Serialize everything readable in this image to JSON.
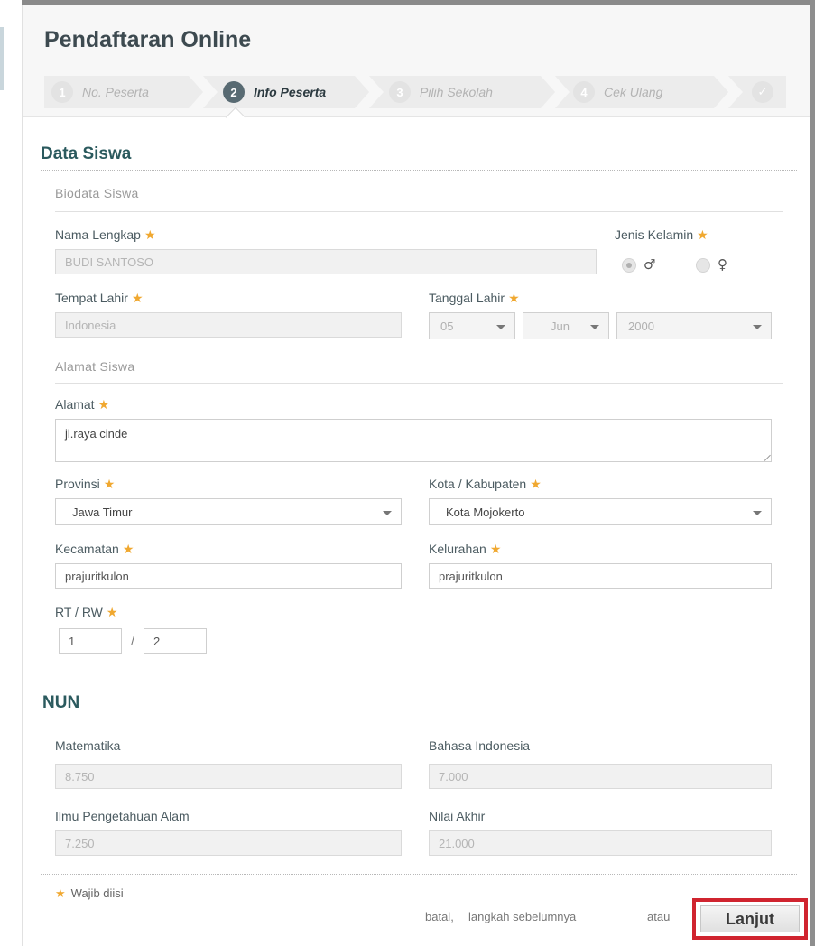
{
  "app": {
    "title": "Pendaftaran Online"
  },
  "wizard": {
    "steps": [
      {
        "num": "1",
        "label": "No. Peserta"
      },
      {
        "num": "2",
        "label": "Info Peserta"
      },
      {
        "num": "3",
        "label": "Pilih Sekolah"
      },
      {
        "num": "4",
        "label": "Cek Ulang"
      },
      {
        "num": "✓",
        "label": ""
      }
    ]
  },
  "data_siswa": {
    "title": "Data Siswa",
    "biodata": {
      "title": "Biodata Siswa",
      "nama_label": "Nama Lengkap",
      "nama_value": "BUDI SANTOSO",
      "gender_label": "Jenis Kelamin",
      "male_symbol": "♂",
      "female_symbol": "♀",
      "tempat_label": "Tempat Lahir",
      "tempat_value": "Indonesia",
      "tanggal_label": "Tanggal Lahir",
      "day": "05",
      "month": "Jun",
      "year": "2000"
    },
    "alamat": {
      "title": "Alamat Siswa",
      "alamat_label": "Alamat",
      "alamat_value": "jl.raya cinde",
      "provinsi_label": "Provinsi",
      "provinsi_value": "Jawa Timur",
      "kota_label": "Kota / Kabupaten",
      "kota_value": "Kota Mojokerto",
      "kecamatan_label": "Kecamatan",
      "kecamatan_value": "prajuritkulon",
      "kelurahan_label": "Kelurahan",
      "kelurahan_value": "prajuritkulon",
      "rtrw_label": "RT / RW",
      "rt_value": "1",
      "separator": "/",
      "rw_value": "2"
    }
  },
  "nun": {
    "title": "NUN",
    "matematika_label": "Matematika",
    "matematika_value": "8.750",
    "bahasa_label": "Bahasa Indonesia",
    "bahasa_value": "7.000",
    "ipa_label": "Ilmu Pengetahuan Alam",
    "ipa_value": "7.250",
    "nilai_label": "Nilai Akhir",
    "nilai_value": "21.000"
  },
  "footer": {
    "required_star": "★",
    "required_note": "Wajib diisi",
    "batal": "batal,",
    "sebelumnya": "langkah sebelumnya",
    "atau": "atau",
    "lanjut": "Lanjut"
  },
  "colors": {
    "accent": "#2b5a5e",
    "required": "#f0a830",
    "highlight": "#d0242f"
  }
}
